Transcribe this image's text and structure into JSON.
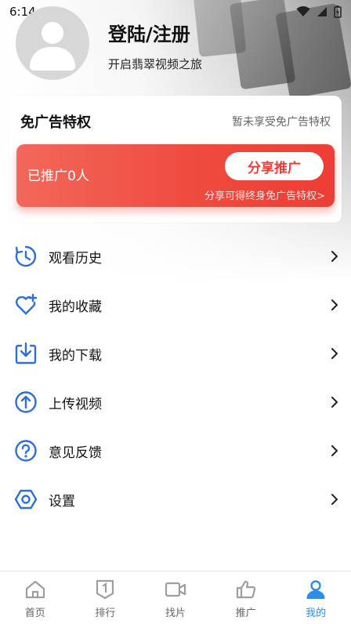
{
  "status_bar": {
    "time": "6:14"
  },
  "profile": {
    "title": "登陆/注册",
    "subtitle": "开启翡翠视频之旅"
  },
  "adfree": {
    "title": "免广告特权",
    "status": "暂未享受免广告特权",
    "promoted_count": "已推广0人",
    "share_button": "分享推广",
    "hint": "分享可得终身免广告特权>"
  },
  "menu": {
    "items": [
      {
        "label": "观看历史",
        "icon": "history-icon"
      },
      {
        "label": "我的收藏",
        "icon": "heart-plus-icon"
      },
      {
        "label": "我的下载",
        "icon": "download-icon"
      },
      {
        "label": "上传视频",
        "icon": "upload-icon"
      },
      {
        "label": "意见反馈",
        "icon": "question-icon"
      },
      {
        "label": "设置",
        "icon": "settings-icon"
      }
    ]
  },
  "bottom_nav": {
    "items": [
      {
        "label": "首页",
        "icon": "home-icon"
      },
      {
        "label": "排行",
        "icon": "ranking-icon"
      },
      {
        "label": "找片",
        "icon": "video-camera-icon"
      },
      {
        "label": "推广",
        "icon": "thumbs-up-icon"
      },
      {
        "label": "我的",
        "icon": "person-icon",
        "active": true
      }
    ]
  },
  "colors": {
    "accent_blue": "#2B8EE8",
    "menu_icon_blue": "#2E6ED8",
    "promo_red": "#EE3D35",
    "inactive_gray": "#9E9E9E"
  }
}
